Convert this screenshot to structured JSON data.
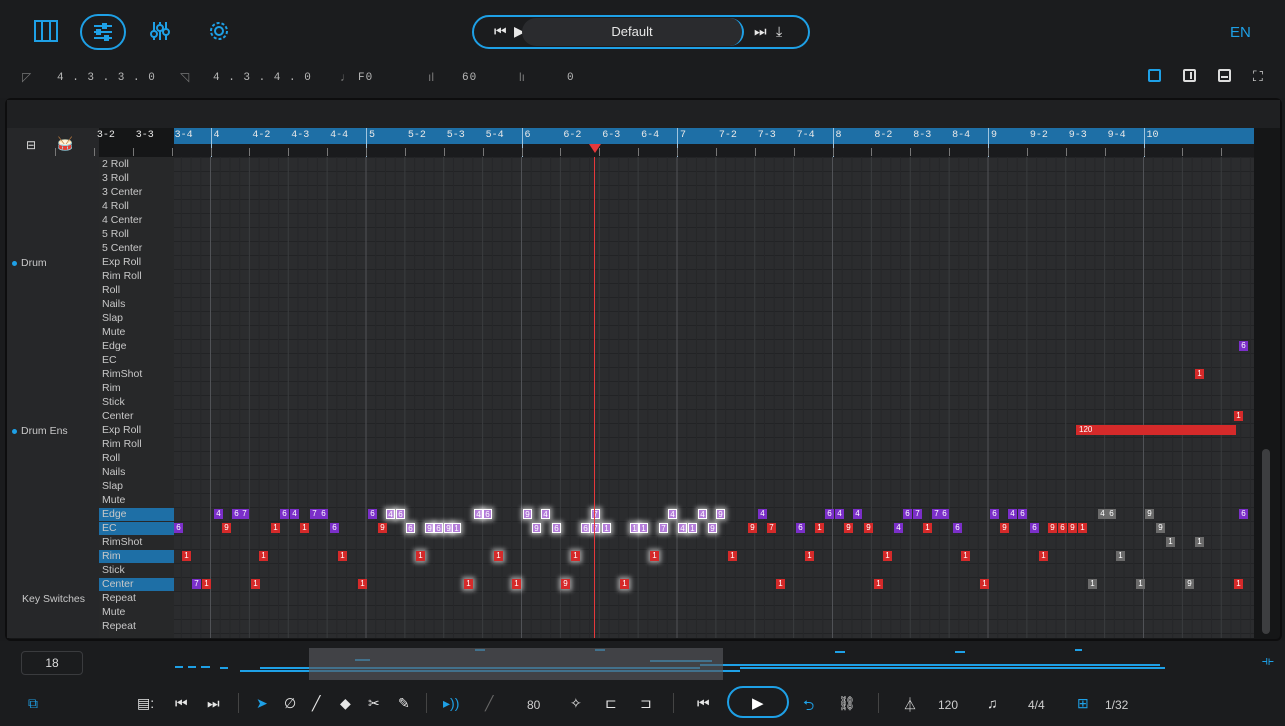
{
  "topbar": {
    "nav": [
      {
        "name": "piano-icon",
        "glyph": "𝄃"
      },
      {
        "name": "mixer-icon",
        "glyph": "☰"
      },
      {
        "name": "sliders-icon",
        "glyph": "⚙"
      },
      {
        "name": "settings-icon",
        "glyph": "⚙"
      }
    ],
    "preset": "Default",
    "language": "EN"
  },
  "infobar": {
    "start_position": "4 . 3 . 3 . 0",
    "end_position": "4 . 3 . 4 . 0",
    "pitch": "F0",
    "velocity": "60",
    "value": "0"
  },
  "ruler": {
    "labels": [
      "3-2",
      "3-3",
      "3-4",
      "4",
      "4-2",
      "4-3",
      "4-4",
      "5",
      "5-2",
      "5-3",
      "5-4",
      "6",
      "6-2",
      "6-3",
      "6-4",
      "7",
      "7-2",
      "7-3",
      "7-4",
      "8",
      "8-2",
      "8-3",
      "8-4",
      "9",
      "9-2",
      "9-3",
      "9-4",
      "10"
    ]
  },
  "groups": [
    {
      "label": "Drum"
    },
    {
      "label": "Drum Ens"
    },
    {
      "label": "Key Switches"
    }
  ],
  "lanes": [
    "2 Roll",
    "3 Roll",
    "3 Center",
    "4 Roll",
    "4 Center",
    "5 Roll",
    "5 Center",
    "Exp Roll",
    "Rim Roll",
    "Roll",
    "Nails",
    "Slap",
    "Mute",
    "Edge",
    "EC",
    "RimShot",
    "Rim",
    "Stick",
    "Center",
    "Exp Roll",
    "Rim Roll",
    "Roll",
    "Nails",
    "Slap",
    "Mute",
    "Edge",
    "EC",
    "RimShot",
    "Rim",
    "Stick",
    "Center",
    "Repeat",
    "Mute",
    "Repeat"
  ],
  "highlighted_lanes": [
    "Edge",
    "EC",
    "Rim",
    "Center"
  ],
  "long_note_label": "120",
  "overview": {
    "zoom_value": "18"
  },
  "toolbar": {
    "velocity_value": "80",
    "tempo": "120",
    "time_signature": "4/4",
    "quantize": "1/32"
  },
  "colors": {
    "accent": "#1ea0e6",
    "note_red": "#d52a2a",
    "note_purple": "#7b2fc9",
    "note_grey": "#6b6b6b",
    "playhead": "#e5383b"
  }
}
